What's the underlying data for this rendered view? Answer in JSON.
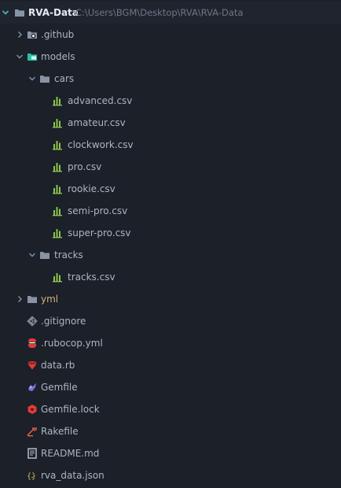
{
  "root": {
    "name": "RVA-Data",
    "path": "C:\\Users\\BGM\\Desktop\\RVA\\RVA-Data"
  },
  "tree": [
    {
      "id": "github",
      "label": ".github",
      "depth": 1,
      "kind": "folder",
      "icon": "github-folder-icon",
      "expanded": false
    },
    {
      "id": "models",
      "label": "models",
      "depth": 1,
      "kind": "folder",
      "icon": "models-folder-icon",
      "expanded": true
    },
    {
      "id": "cars",
      "label": "cars",
      "depth": 2,
      "kind": "folder",
      "icon": "folder-icon",
      "expanded": true
    },
    {
      "id": "advanced-csv",
      "label": "advanced.csv",
      "depth": 3,
      "kind": "file",
      "icon": "csv-icon"
    },
    {
      "id": "amateur-csv",
      "label": "amateur.csv",
      "depth": 3,
      "kind": "file",
      "icon": "csv-icon"
    },
    {
      "id": "clockwork-csv",
      "label": "clockwork.csv",
      "depth": 3,
      "kind": "file",
      "icon": "csv-icon"
    },
    {
      "id": "pro-csv",
      "label": "pro.csv",
      "depth": 3,
      "kind": "file",
      "icon": "csv-icon"
    },
    {
      "id": "rookie-csv",
      "label": "rookie.csv",
      "depth": 3,
      "kind": "file",
      "icon": "csv-icon"
    },
    {
      "id": "semi-pro-csv",
      "label": "semi-pro.csv",
      "depth": 3,
      "kind": "file",
      "icon": "csv-icon"
    },
    {
      "id": "super-pro-csv",
      "label": "super-pro.csv",
      "depth": 3,
      "kind": "file",
      "icon": "csv-icon"
    },
    {
      "id": "tracks",
      "label": "tracks",
      "depth": 2,
      "kind": "folder",
      "icon": "folder-icon",
      "expanded": true
    },
    {
      "id": "tracks-csv",
      "label": "tracks.csv",
      "depth": 3,
      "kind": "file",
      "icon": "csv-icon"
    },
    {
      "id": "yml",
      "label": "yml",
      "depth": 1,
      "kind": "folder",
      "icon": "folder-icon",
      "expanded": false,
      "accent": "yml"
    },
    {
      "id": "gitignore",
      "label": ".gitignore",
      "depth": 1,
      "kind": "file",
      "icon": "git-icon"
    },
    {
      "id": "rubocop",
      "label": ".rubocop.yml",
      "depth": 1,
      "kind": "file",
      "icon": "rubocop-icon"
    },
    {
      "id": "data-rb",
      "label": "data.rb",
      "depth": 1,
      "kind": "file",
      "icon": "ruby-icon"
    },
    {
      "id": "gemfile",
      "label": "Gemfile",
      "depth": 1,
      "kind": "file",
      "icon": "gemfile-icon"
    },
    {
      "id": "gemfile-lock",
      "label": "Gemfile.lock",
      "depth": 1,
      "kind": "file",
      "icon": "gemfile-lock-icon"
    },
    {
      "id": "rakefile",
      "label": "Rakefile",
      "depth": 1,
      "kind": "file",
      "icon": "rakefile-icon"
    },
    {
      "id": "readme",
      "label": "README.md",
      "depth": 1,
      "kind": "file",
      "icon": "markdown-icon"
    },
    {
      "id": "rva-data-json",
      "label": "rva_data.json",
      "depth": 1,
      "kind": "file",
      "icon": "json-icon"
    }
  ],
  "colors": {
    "background": "#1b2029",
    "root_row": "#1f252f",
    "text": "#aeb5c2",
    "path": "#6f7683",
    "csv": "#8bc34a",
    "folder": "#8893a5",
    "models_folder": "#2bbfa3",
    "ruby": "#e53935",
    "yml_text": "#d7b07d"
  }
}
